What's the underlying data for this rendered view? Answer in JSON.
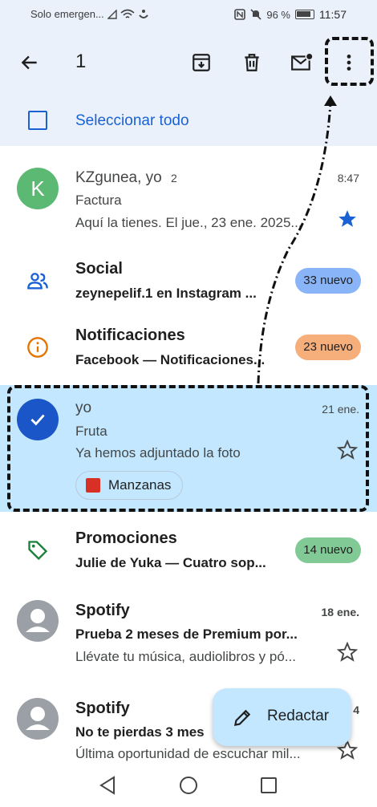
{
  "status_bar": {
    "carrier": "Solo emergen...",
    "battery_text": "96 %",
    "time": "11:57"
  },
  "toolbar": {
    "selected_count": "1"
  },
  "select_all": {
    "label": "Seleccionar todo"
  },
  "inbox": [
    {
      "avatar_letter": "K",
      "avatar_color": "#5bb974",
      "sender": "KZgunea, yo",
      "thread_count": "2",
      "time": "8:47",
      "subject": "Factura",
      "snippet": "Aquí la tienes. El jue., 23 ene. 2025...",
      "starred": true
    },
    {
      "category_icon": "people-icon",
      "name": "Social",
      "snippet": "zeynepelif.1 en Instagram ...",
      "badge": "33 nuevo",
      "badge_color": "#8ab4f8"
    },
    {
      "category_icon": "info-icon",
      "name": "Notificaciones",
      "snippet": "Facebook — Notificaciones...",
      "badge": "23 nuevo",
      "badge_color": "#f6ae7b"
    },
    {
      "selected": true,
      "sender": "yo",
      "time": "21 ene.",
      "subject": "Fruta",
      "snippet": "Ya hemos adjuntado la foto",
      "attachment": "Manzanas",
      "starred": false
    },
    {
      "category_icon": "tag-icon",
      "name": "Promociones",
      "snippet": "Julie de Yuka — Cuatro sop...",
      "badge": "14 nuevo",
      "badge_color": "#81c995"
    },
    {
      "sender": "Spotify",
      "time": "18 ene.",
      "subject": "Prueba 2 meses de Premium por...",
      "snippet": "Llévate tu música, audiolibros y pó...",
      "starred": false
    },
    {
      "sender": "Spotify",
      "time": "4",
      "subject": "No te pierdas 3 mes",
      "snippet": "Última oportunidad de escuchar mil...",
      "starred": false
    }
  ],
  "fab": {
    "label": "Redactar"
  },
  "colors": {
    "accent": "#1a61d4",
    "header_bg": "#eaf1fb",
    "selected_bg": "#c2e7ff"
  }
}
